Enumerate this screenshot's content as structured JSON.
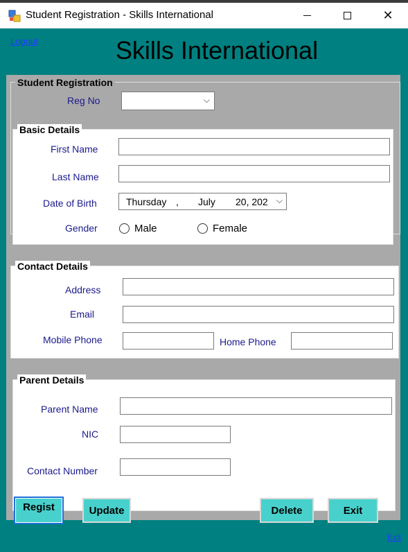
{
  "window": {
    "title": "Student Registration - Skills International",
    "icon": "windows-form-icon",
    "controls": [
      "minimize-icon",
      "maximize-icon",
      "close-icon"
    ]
  },
  "header": {
    "logout_label": "Logout",
    "app_title": "Skills International",
    "exit_label": "Exit"
  },
  "registration": {
    "group_title": "Student Registration",
    "reg_no_label": "Reg No",
    "reg_no_value": ""
  },
  "basic": {
    "group_title": "Basic Details",
    "first_name_label": "First Name",
    "first_name_value": "",
    "last_name_label": "Last Name",
    "last_name_value": "",
    "dob_label": "Date of Birth",
    "dob_day": "Thursday",
    "dob_sep": ",",
    "dob_month": "July",
    "dob_date": "20, 202",
    "gender_label": "Gender",
    "gender_options": [
      "Male",
      "Female"
    ],
    "gender_selected": ""
  },
  "contact": {
    "group_title": "Contact Details",
    "address_label": "Address",
    "address_value": "",
    "email_label": "Email",
    "email_value": "",
    "mobile_label": "Mobile Phone",
    "mobile_value": "",
    "home_label": "Home Phone",
    "home_value": ""
  },
  "parent": {
    "group_title": "Parent Details",
    "name_label": "Parent Name",
    "name_value": "",
    "nic_label": "NIC",
    "nic_value": "",
    "contact_label": "Contact Number",
    "contact_value": ""
  },
  "buttons": {
    "register": "Regist",
    "update": "Update",
    "delete": "Delete",
    "exit": "Exit"
  },
  "colors": {
    "background": "#008080",
    "panel": "#a9a9a9",
    "button": "#48d1cc",
    "label_text": "#1a1a8c",
    "link": "#1f3cff"
  }
}
